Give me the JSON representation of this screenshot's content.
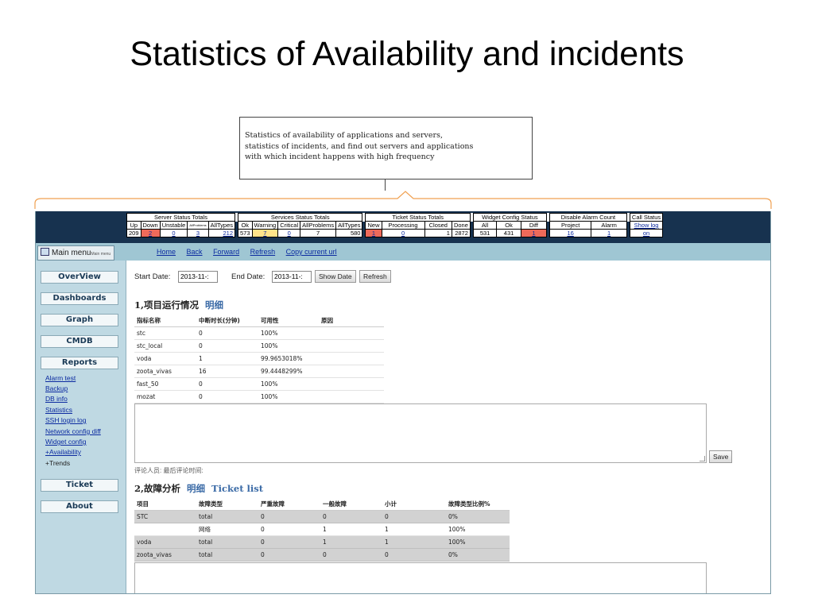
{
  "slide": {
    "title": "Statistics of Availability and incidents",
    "callout": "Statistics of availability of applications and servers,\nstatistics of incidents, and find out servers and applications\nwith which incident happens with high frequency"
  },
  "status": {
    "groups": [
      "Server Status Totals",
      "Services Status Totals",
      "Ticket Status Totals",
      "Widget Config Status",
      "Disable Alarm Count",
      "Call Status"
    ],
    "server": {
      "headers": [
        "Up",
        "Down",
        "Unstable",
        "AllProblems",
        "AllTypes"
      ],
      "values": [
        "209",
        "2",
        "0",
        "3",
        "212"
      ]
    },
    "services": {
      "headers": [
        "Ok",
        "Warning",
        "Critical",
        "AllProblems",
        "AllTypes"
      ],
      "values": [
        "573",
        "7",
        "0",
        "7",
        "580"
      ]
    },
    "ticket": {
      "headers": [
        "New",
        "Processing",
        "Closed",
        "Done"
      ],
      "values": [
        "1",
        "0",
        "1",
        "2872"
      ]
    },
    "widget": {
      "headers": [
        "All",
        "Ok",
        "Diff"
      ],
      "values": [
        "531",
        "431",
        "1"
      ]
    },
    "alarm": {
      "headers": [
        "Project",
        "Alarm"
      ],
      "values": [
        "16",
        "1"
      ]
    },
    "call": {
      "headers": [
        "Show log"
      ],
      "values": [
        "on"
      ]
    },
    "colors": {
      "alert": "#ee6a5a",
      "warning": "#ffe48a",
      "header_bg": "#17324f"
    }
  },
  "nav": {
    "main_menu": "Main menu",
    "main_menu_small": "Main menu",
    "links": [
      "Home",
      "Back",
      "Forward",
      "Refresh",
      "Copy current url"
    ]
  },
  "sidebar": {
    "buttons": [
      "OverView",
      "Dashboards",
      "Graph",
      "CMDB",
      "Reports"
    ],
    "report_links": [
      "Alarm test",
      "Backup",
      "DB info",
      "Statistics",
      "SSH login log",
      "Network config diff",
      "Widget config"
    ],
    "availability": "+Availability",
    "trends": "+Trends",
    "bottom_buttons": [
      "Ticket",
      "About"
    ]
  },
  "filter": {
    "start_label": "Start Date:",
    "start_value": "2013-11-:",
    "end_label": "End  Date:",
    "end_value": "2013-11-:",
    "show_button": "Show Date",
    "refresh_button": "Refresh"
  },
  "section1": {
    "title": "1,项目运行情况",
    "link": "明细",
    "headers": [
      "指标名称",
      "中断时长(分钟)",
      "可用性",
      "原因"
    ],
    "rows": [
      [
        "stc",
        "0",
        "100%",
        ""
      ],
      [
        "stc_local",
        "0",
        "100%",
        ""
      ],
      [
        "voda",
        "1",
        "99.9653018%",
        ""
      ],
      [
        "zoota_vivas",
        "16",
        "99.4448299%",
        ""
      ],
      [
        "fast_50",
        "0",
        "100%",
        ""
      ],
      [
        "mozat",
        "0",
        "100%",
        ""
      ]
    ],
    "save_button": "Save",
    "comment_label": "评论人员: 最后评论时间:"
  },
  "section2": {
    "title": "2,故障分析",
    "link1": "明细",
    "link2": "Ticket list",
    "headers": [
      "项目",
      "故障类型",
      "严重故障",
      "一般故障",
      "小计",
      "故障类型比例%"
    ],
    "rows": [
      [
        "STC",
        "total",
        "0",
        "0",
        "0",
        "0%"
      ],
      [
        "",
        "网络",
        "0",
        "1",
        "1",
        "100%"
      ],
      [
        "voda",
        "total",
        "0",
        "1",
        "1",
        "100%"
      ],
      [
        "zoota_vivas",
        "total",
        "0",
        "0",
        "0",
        "0%"
      ]
    ]
  }
}
